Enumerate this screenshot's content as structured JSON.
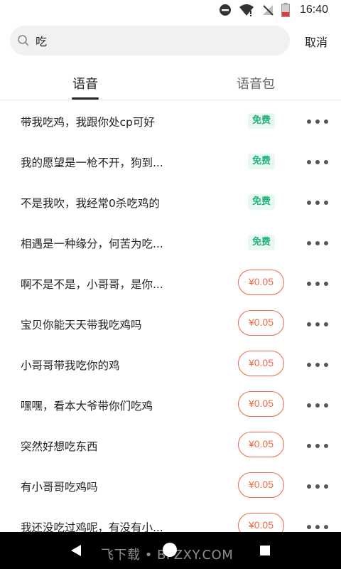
{
  "status_bar": {
    "time": "16:40",
    "icons": [
      "do-not-disturb-icon",
      "wifi-icon",
      "no-signal-icon",
      "battery-low-icon"
    ],
    "battery_color": "#e53935"
  },
  "search": {
    "query": "吃",
    "cancel_label": "取消"
  },
  "tabs": [
    {
      "label": "语音",
      "active": true
    },
    {
      "label": "语音包",
      "active": false
    }
  ],
  "colors": {
    "free_text": "#21b37a",
    "free_bg": "#eaf8f2",
    "price": "#f06848"
  },
  "items": [
    {
      "title": "带我吃鸡，我跟你处cp可好",
      "badge": "免费",
      "paid": false
    },
    {
      "title": "我的愿望是一枪不开，狗到...",
      "badge": "免费",
      "paid": false
    },
    {
      "title": "不是我吹，我经常0杀吃鸡的",
      "badge": "免费",
      "paid": false
    },
    {
      "title": "相遇是一种缘分，何苦为吃...",
      "badge": "免费",
      "paid": false
    },
    {
      "title": "啊不是不是，小哥哥，是你...",
      "badge": "¥0.05",
      "paid": true
    },
    {
      "title": "宝贝你能天天带我吃鸡吗",
      "badge": "¥0.05",
      "paid": true
    },
    {
      "title": "小哥哥带我吃你的鸡",
      "badge": "¥0.05",
      "paid": true
    },
    {
      "title": "嘿嘿，看本大爷带你们吃鸡",
      "badge": "¥0.05",
      "paid": true
    },
    {
      "title": "突然好想吃东西",
      "badge": "¥0.05",
      "paid": true
    },
    {
      "title": "有小哥哥吃鸡吗",
      "badge": "¥0.05",
      "paid": true
    },
    {
      "title": "我还没吃过鸡呢，有没有小...",
      "badge": "¥0.05",
      "paid": true
    }
  ],
  "watermark": "飞下载 • BFZXY.COM"
}
